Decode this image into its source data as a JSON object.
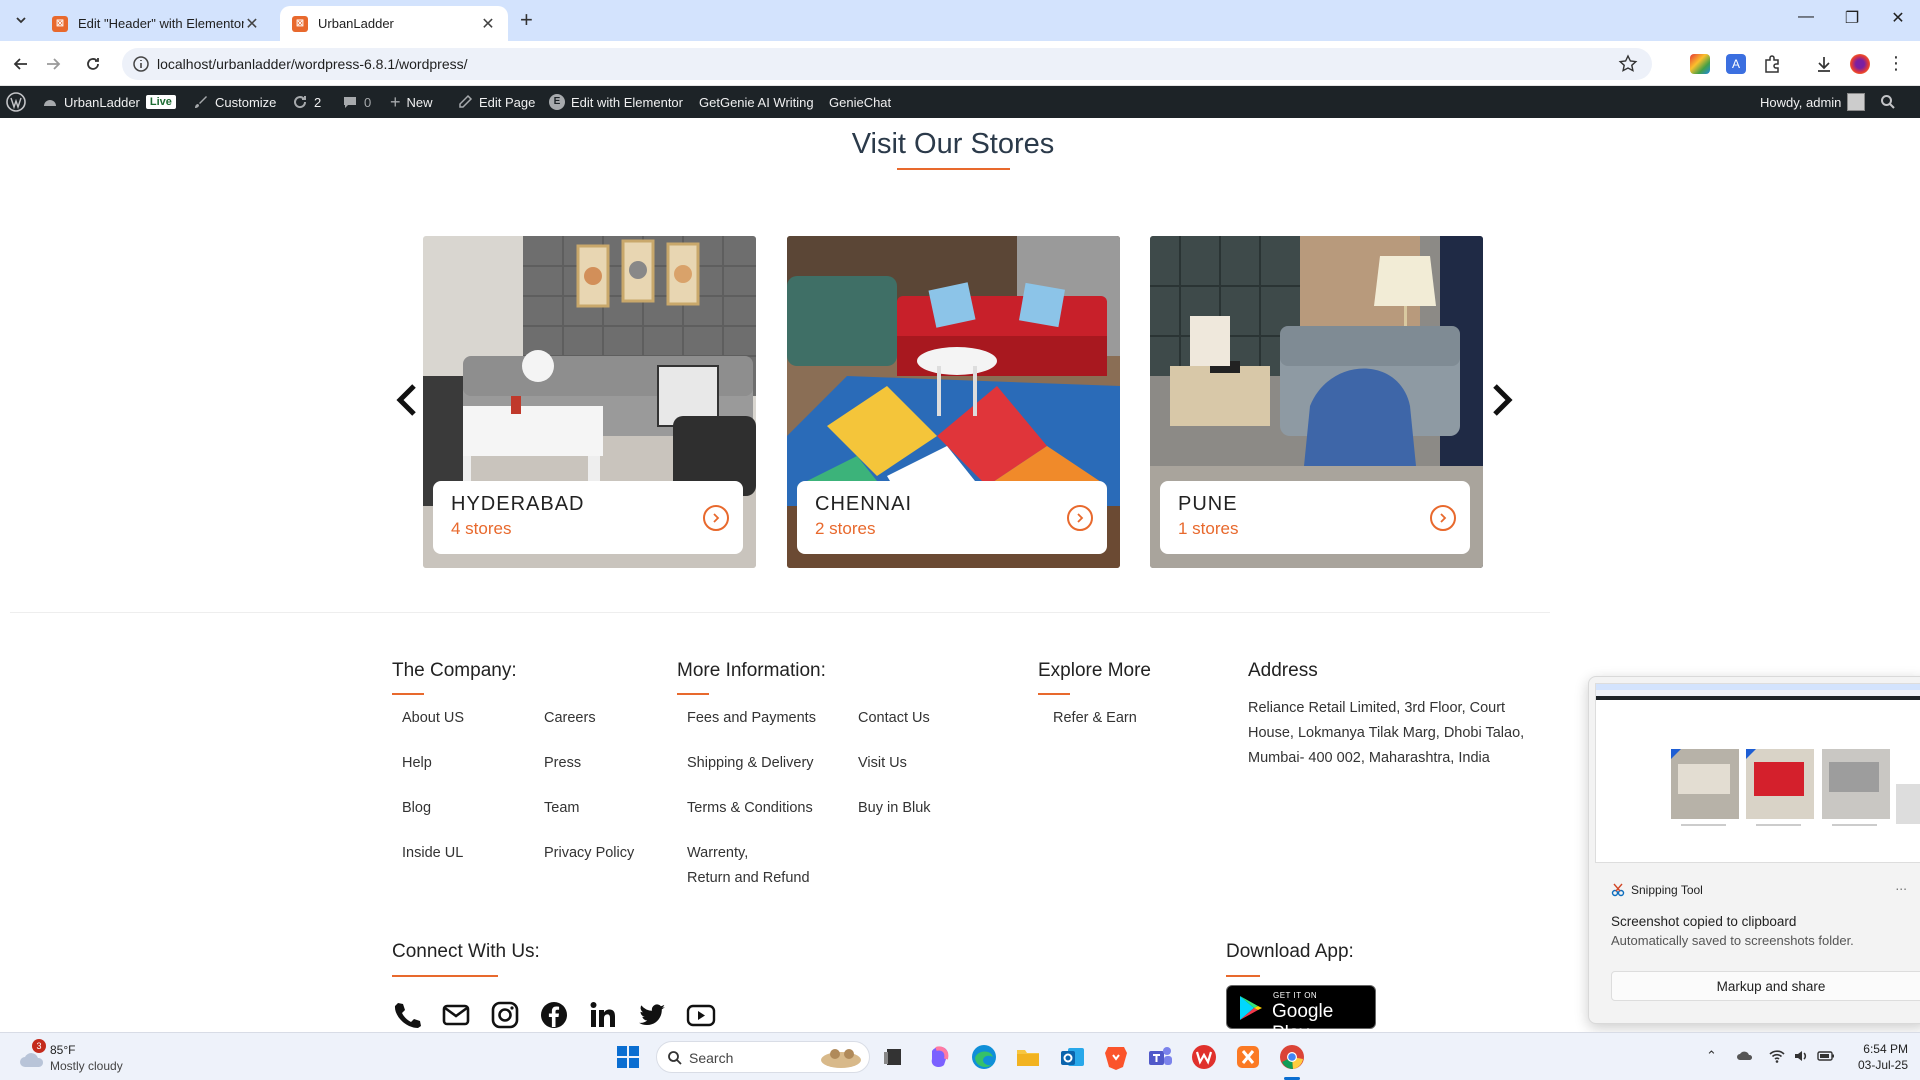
{
  "browser": {
    "tabs": [
      {
        "title": "Edit \"Header\" with Elementor"
      },
      {
        "title": "UrbanLadder"
      }
    ],
    "url": "localhost/urbanladder/wordpress-6.8.1/wordpress/"
  },
  "adminbar": {
    "site": "UrbanLadder",
    "live": "Live",
    "customize": "Customize",
    "updates": "2",
    "comments": "0",
    "new": "New",
    "edit_page": "Edit Page",
    "edit_elementor": "Edit with Elementor",
    "getgenie": "GetGenie AI Writing",
    "geniechat": "GenieChat",
    "howdy": "Howdy, admin"
  },
  "stores": {
    "title": "Visit Our Stores",
    "cards": [
      {
        "city": "HYDERABAD",
        "count": "4 stores"
      },
      {
        "city": "CHENNAI",
        "count": "2 stores"
      },
      {
        "city": "PUNE",
        "count": "1 stores"
      }
    ]
  },
  "footer": {
    "company": {
      "title": "The Company:",
      "col1": [
        "About US",
        "Help",
        "Blog",
        "Inside UL"
      ],
      "col2": [
        "Careers",
        "Press",
        "Team",
        "Privacy Policy"
      ]
    },
    "more": {
      "title": "More Information:",
      "col1": [
        "Fees and Payments",
        "Shipping & Delivery",
        "Terms & Conditions",
        "Warrenty,",
        "Return and Refund"
      ],
      "col2": [
        "Contact Us",
        "Visit Us",
        "Buy in Bluk"
      ]
    },
    "explore": {
      "title": "Explore More",
      "links": [
        "Refer & Earn"
      ]
    },
    "address": {
      "title": "Address",
      "text": "Reliance Retail Limited, 3rd Floor, Court House, Lokmanya Tilak Marg, Dhobi Talao, Mumbai- 400 002, Maharashtra, India"
    },
    "connect": {
      "title": "Connect With Us:"
    },
    "download": {
      "title": "Download App:",
      "badge_small": "GET IT ON",
      "badge_big": "Google Play"
    }
  },
  "toast": {
    "app": "Snipping Tool",
    "more": "...",
    "heading": "Screenshot copied to clipboard",
    "sub": "Automatically saved to screenshots folder.",
    "button": "Markup and share"
  },
  "taskbar": {
    "weather_badge": "3",
    "temp": "85°F",
    "condition": "Mostly cloudy",
    "search": "Search",
    "time": "6:54 PM",
    "date": "03-Jul-25"
  },
  "colors": {
    "accent": "#e8692d",
    "adminbar": "#1d2327",
    "tabbar": "#d3e3fd"
  }
}
